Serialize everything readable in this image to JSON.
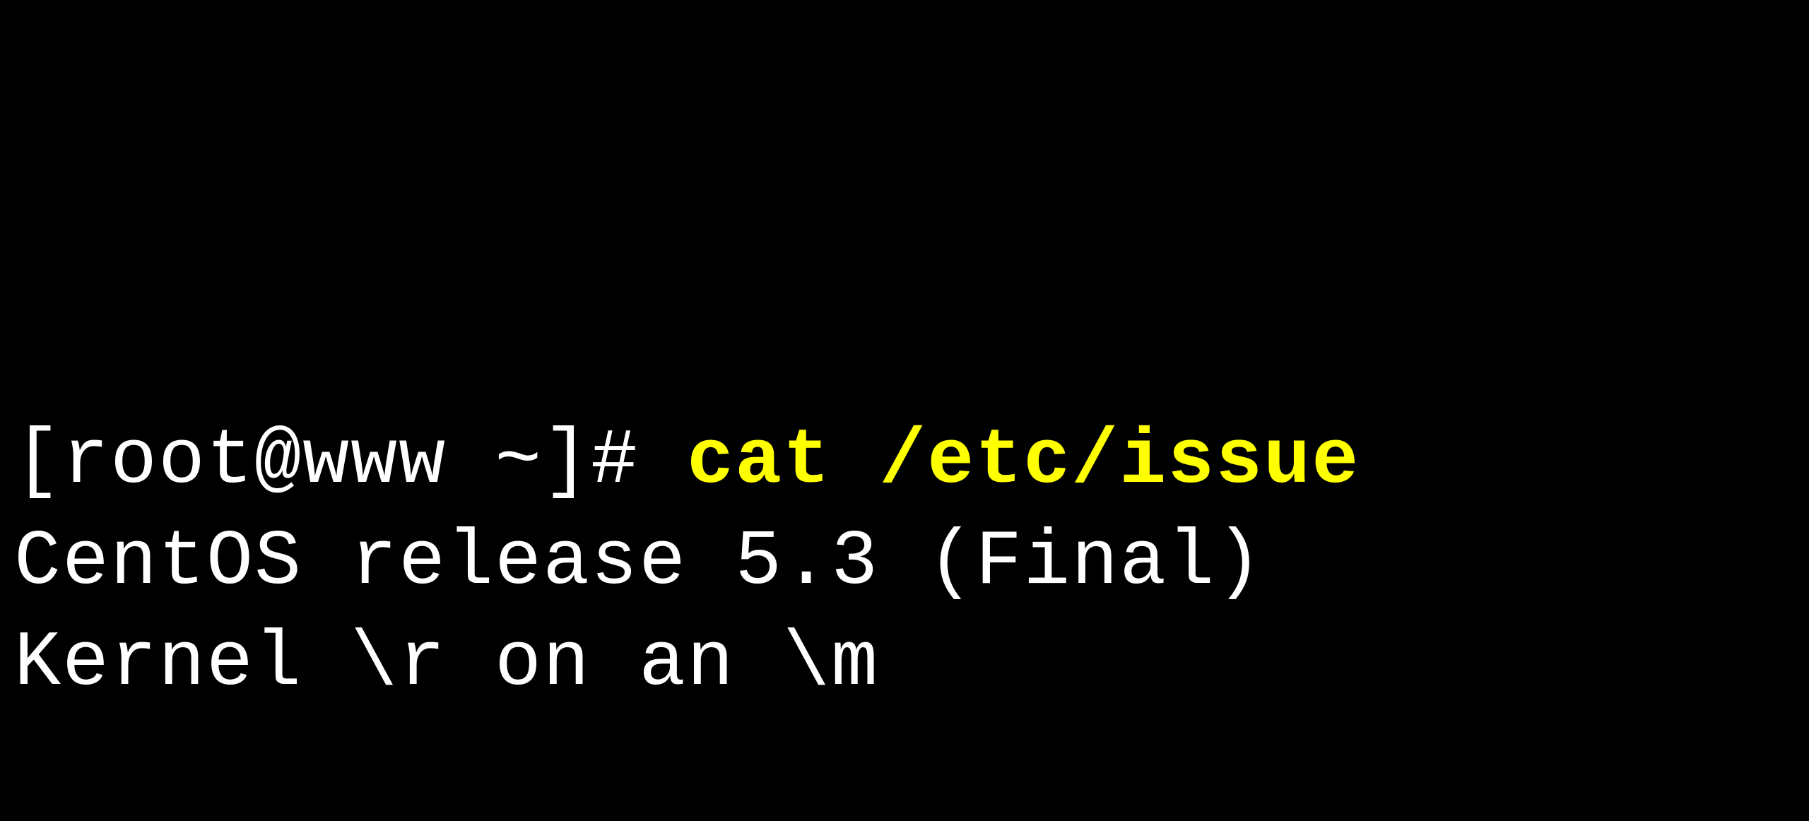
{
  "terminal": {
    "prompt": "[root@www ~]# ",
    "command": "cat /etc/issue",
    "output_lines": [
      "CentOS release 5.3 (Final)",
      "Kernel \\r on an \\m"
    ]
  }
}
